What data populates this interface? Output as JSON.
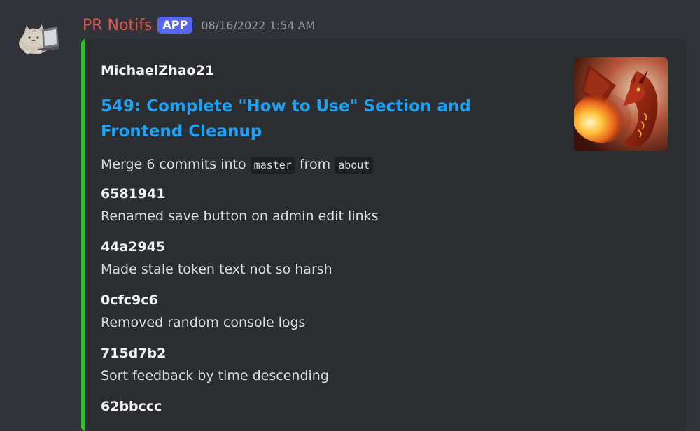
{
  "message": {
    "username": "PR Notifs",
    "tag": "APP",
    "timestamp": "08/16/2022 1:54 AM",
    "avatar_icon": "pusheen-cat-laptop-icon"
  },
  "embed": {
    "accent_color": "#2bc02b",
    "author": "MichaelZhao21",
    "title": "549: Complete \"How to Use\" Section and Frontend Cleanup",
    "description": {
      "prefix": "Merge 6 commits into ",
      "target_branch": "master",
      "middle": " from ",
      "source_branch": "about"
    },
    "commits": [
      {
        "hash": "6581941",
        "message": "Renamed save button on admin edit links"
      },
      {
        "hash": "44a2945",
        "message": "Made stale token text not so harsh"
      },
      {
        "hash": "0cfc9c6",
        "message": "Removed random console logs"
      },
      {
        "hash": "715d7b2",
        "message": "Sort feedback by time descending"
      },
      {
        "hash": "62bbccc",
        "message": ""
      }
    ],
    "thumbnail": "fire-breathing-dragon-image"
  },
  "colors": {
    "background": "#313338",
    "embed_background": "#2b2d31",
    "username": "#e0584f",
    "app_tag": "#5865f2",
    "link": "#1ea1f2"
  }
}
